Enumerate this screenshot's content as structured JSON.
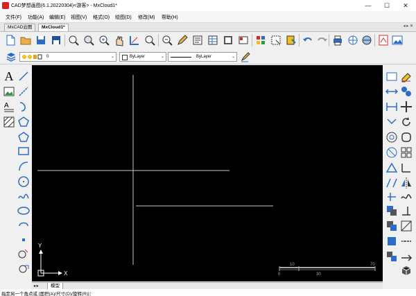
{
  "window": {
    "title": "CAD梦想画图(6.1.20220304)<游客> - MxCloud1*",
    "minimize": "—",
    "maximize": "☐",
    "close": "✕"
  },
  "menu": [
    "文件(F)",
    "功能(A)",
    "编辑(E)",
    "视图(V)",
    "格式(O)",
    "绘图(D)",
    "修改(M)",
    "帮助(H)"
  ],
  "tabs": [
    "MxCAD云图",
    "MxCloud1*"
  ],
  "tab_nav": "◂ ▸ ✕",
  "layer_combo": {
    "value": "0"
  },
  "color_combo": {
    "value": "ByLayer"
  },
  "linetype_combo": {
    "value": "ByLayer"
  },
  "canvas": {
    "ucs_x": "X",
    "ucs_y": "Y",
    "scale_labels": [
      "10",
      "70",
      "0",
      "30"
    ]
  },
  "layout_tabs": {
    "model": "模型"
  },
  "command_line": "指定另一个角点或 [面积(A)/尺寸(D)/旋转(R)]：",
  "colors": {
    "canvas_bg": "#000000",
    "drawing_lines": "#c8c8c8",
    "accent_red": "#d42a2a",
    "accent_blue": "#2a6cc8"
  }
}
